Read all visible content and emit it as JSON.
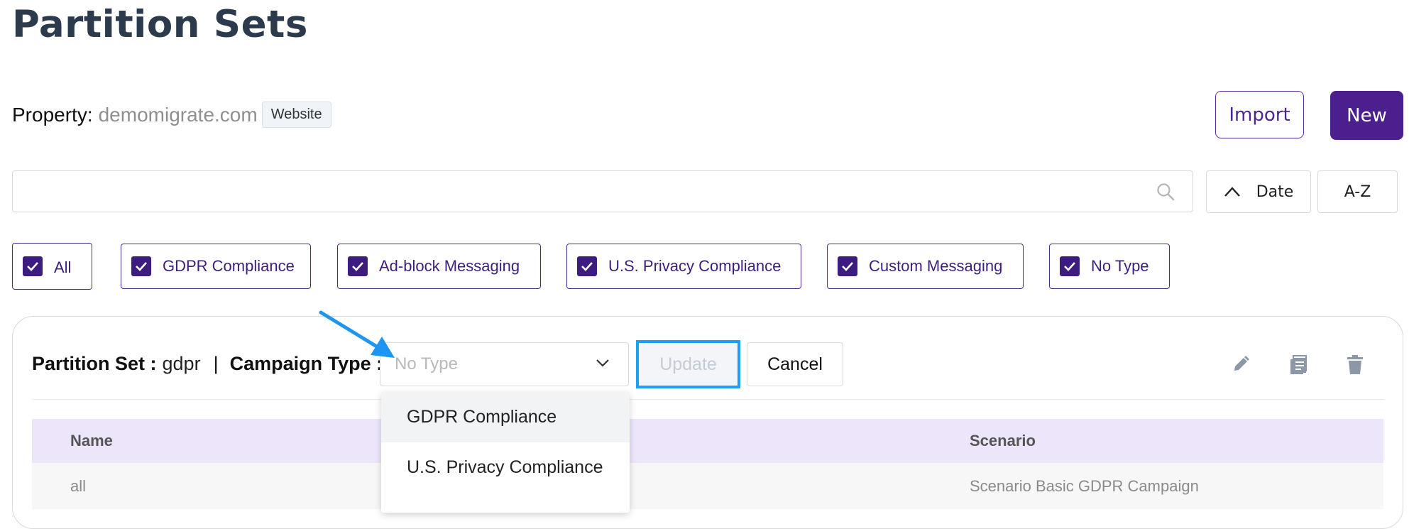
{
  "page": {
    "title": "Partition Sets"
  },
  "property": {
    "label": "Property:",
    "value": "demomigrate.com",
    "badge": "Website"
  },
  "actions": {
    "import": "Import",
    "new": "New"
  },
  "search": {
    "placeholder": ""
  },
  "sort": {
    "date": "Date",
    "az": "A-Z"
  },
  "filters": [
    {
      "label": "All",
      "checked": true
    },
    {
      "label": "GDPR Compliance",
      "checked": true
    },
    {
      "label": "Ad-block Messaging",
      "checked": true
    },
    {
      "label": "U.S. Privacy Compliance",
      "checked": true
    },
    {
      "label": "Custom Messaging",
      "checked": true
    },
    {
      "label": "No Type",
      "checked": true
    }
  ],
  "partition": {
    "label": "Partition Set :",
    "value": "gdpr",
    "separator": "|",
    "campaign_label": "Campaign Type :",
    "campaign_placeholder": "No Type",
    "update": "Update",
    "cancel": "Cancel"
  },
  "dropdown": {
    "options": [
      "GDPR Compliance",
      "U.S. Privacy Compliance"
    ],
    "highlighted": 0
  },
  "table": {
    "headers": [
      "Name",
      "Scenario"
    ],
    "rows": [
      [
        "all",
        "Scenario Basic GDPR Campaign"
      ]
    ]
  },
  "colors": {
    "brand": "#4c1f8f",
    "highlight": "#1ea0f2",
    "table_header": "#ede6fb"
  }
}
